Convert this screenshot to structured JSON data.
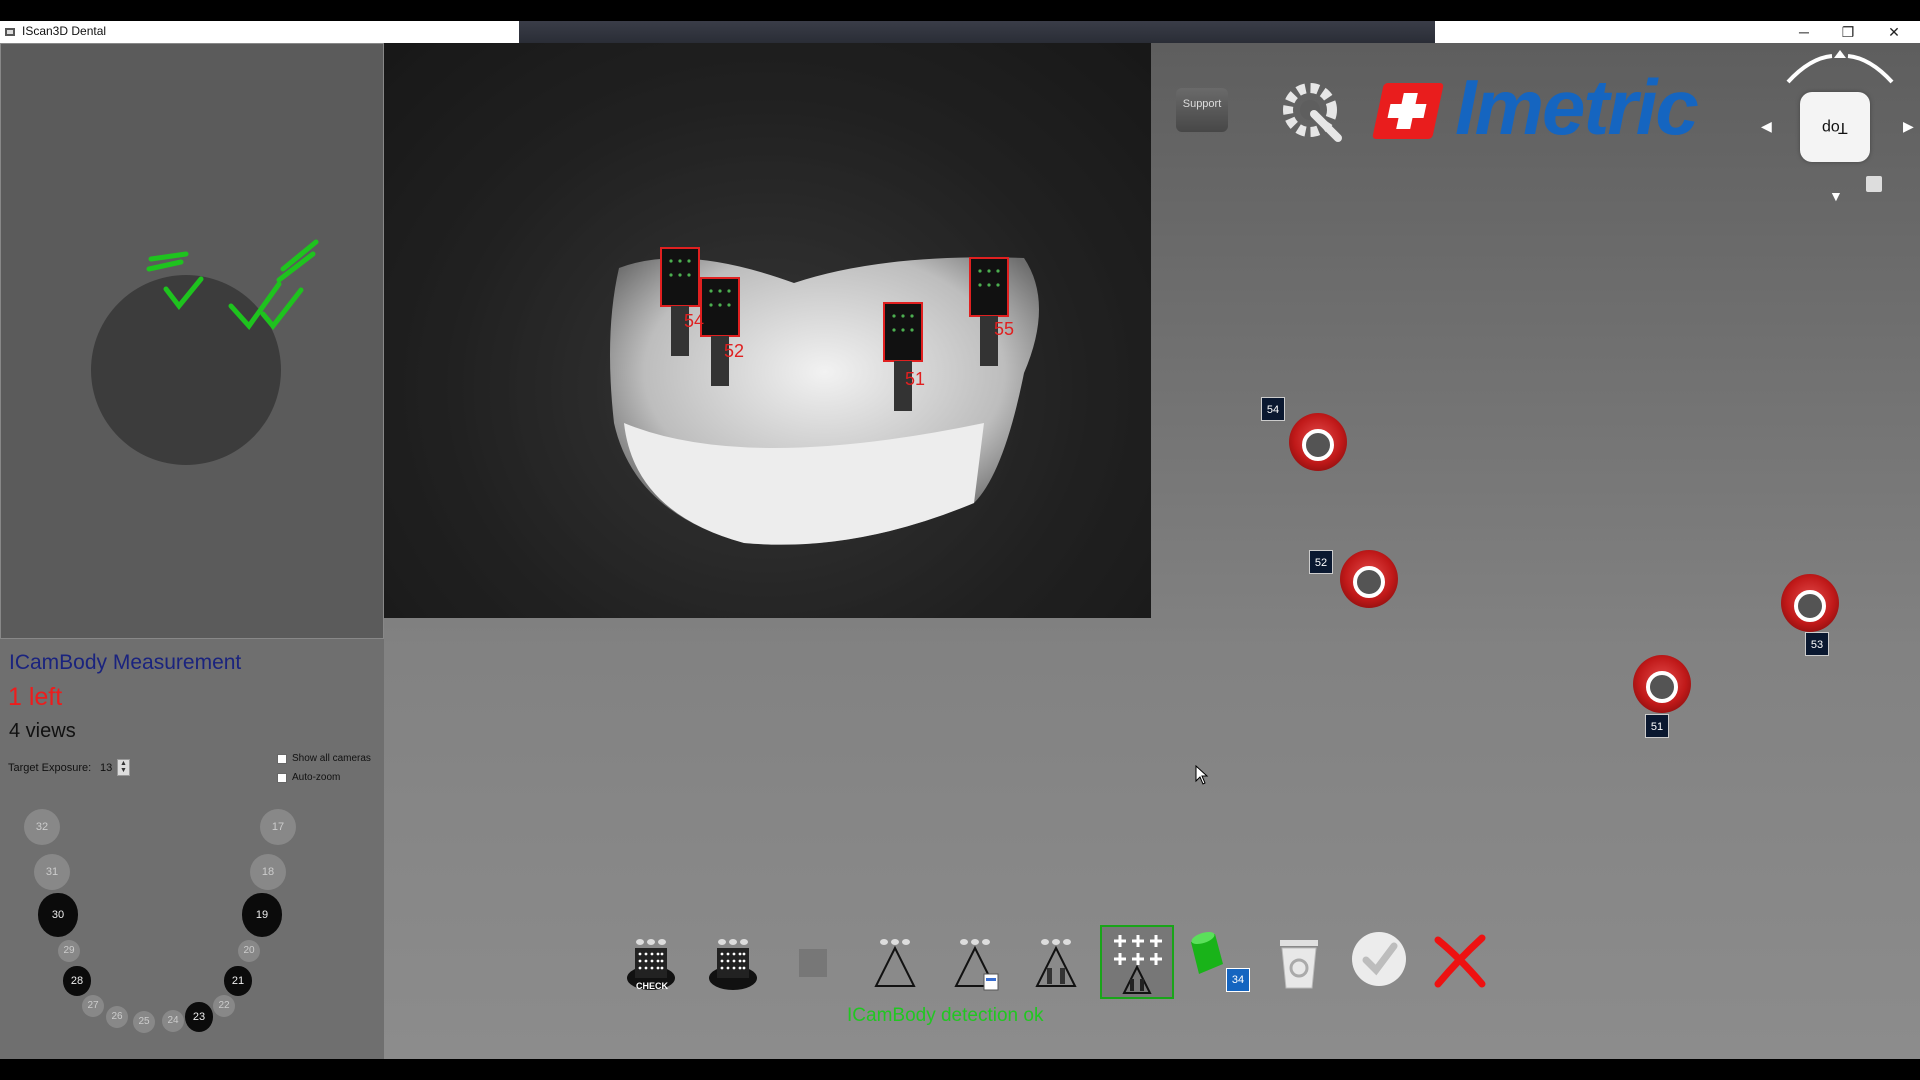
{
  "window": {
    "title": "IScan3D Dental",
    "controls": {
      "minimize": "─",
      "restore": "❐",
      "close": "✕"
    }
  },
  "left_panel": {
    "measurement_title": "ICamBody Measurement",
    "remaining": "1 left",
    "views": "4 views",
    "exposure_label": "Target Exposure:",
    "exposure_value": "13",
    "show_all_cameras": "Show all cameras",
    "auto_zoom": "Auto-zoom",
    "teeth": {
      "t32": "32",
      "t31": "31",
      "t30": "30",
      "t29": "29",
      "t28": "28",
      "t27": "27",
      "t26": "26",
      "t25": "25",
      "t24": "24",
      "t23": "23",
      "t22": "22",
      "t21": "21",
      "t20": "20",
      "t19": "19",
      "t18": "18",
      "t17": "17"
    }
  },
  "camera": {
    "labels": {
      "l54": "54",
      "l52": "52",
      "l51": "51",
      "l55": "55"
    }
  },
  "header": {
    "support_label": "Support",
    "logo_text": "Imetric",
    "view_cube_label": "Top"
  },
  "scene_markers": {
    "m54": "54",
    "m52": "52",
    "m53": "53",
    "m51": "51"
  },
  "toolbar": {
    "check_label": "CHECK",
    "badge_count": "34",
    "status": "ICamBody detection ok"
  },
  "colors": {
    "accent_blue": "#1565c0",
    "logo_red": "#e91d1d",
    "status_green": "#21c721",
    "remaining_red": "#ee1c1c",
    "marker_red": "#c01919"
  }
}
